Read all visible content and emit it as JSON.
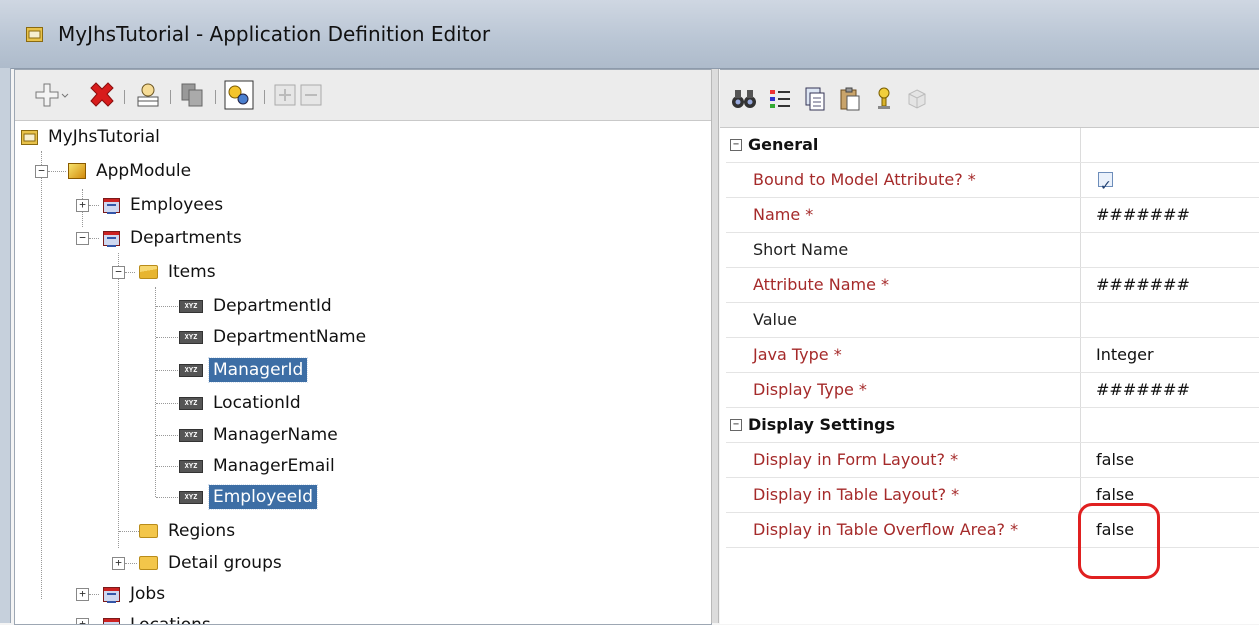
{
  "window": {
    "title": "MyJhsTutorial - Application Definition Editor"
  },
  "tree": {
    "root": "MyJhsTutorial",
    "module": "AppModule",
    "employees": "Employees",
    "departments": "Departments",
    "items_folder": "Items",
    "items": [
      "DepartmentId",
      "DepartmentName",
      "ManagerId",
      "LocationId",
      "ManagerName",
      "ManagerEmail",
      "EmployeeId"
    ],
    "regions": "Regions",
    "detail_groups": "Detail groups",
    "jobs": "Jobs",
    "locations": "Locations"
  },
  "icon_badge": "XYZ",
  "properties": {
    "general_header": "General",
    "display_header": "Display Settings",
    "rows": [
      {
        "name": "Bound to Model Attribute? *",
        "value": "",
        "checked": true
      },
      {
        "name": "Name *",
        "value": "#######"
      },
      {
        "name": "Short Name",
        "value": ""
      },
      {
        "name": "Attribute Name *",
        "value": "#######"
      },
      {
        "name": "Value",
        "value": ""
      },
      {
        "name": "Java Type *",
        "value": "Integer"
      },
      {
        "name": "Display Type *",
        "value": "#######"
      }
    ],
    "display_rows": [
      {
        "name": "Display in Form Layout? *",
        "value": "false"
      },
      {
        "name": "Display in Table Layout? *",
        "value": "false"
      },
      {
        "name": "Display in Table Overflow Area? *",
        "value": "false"
      }
    ]
  }
}
